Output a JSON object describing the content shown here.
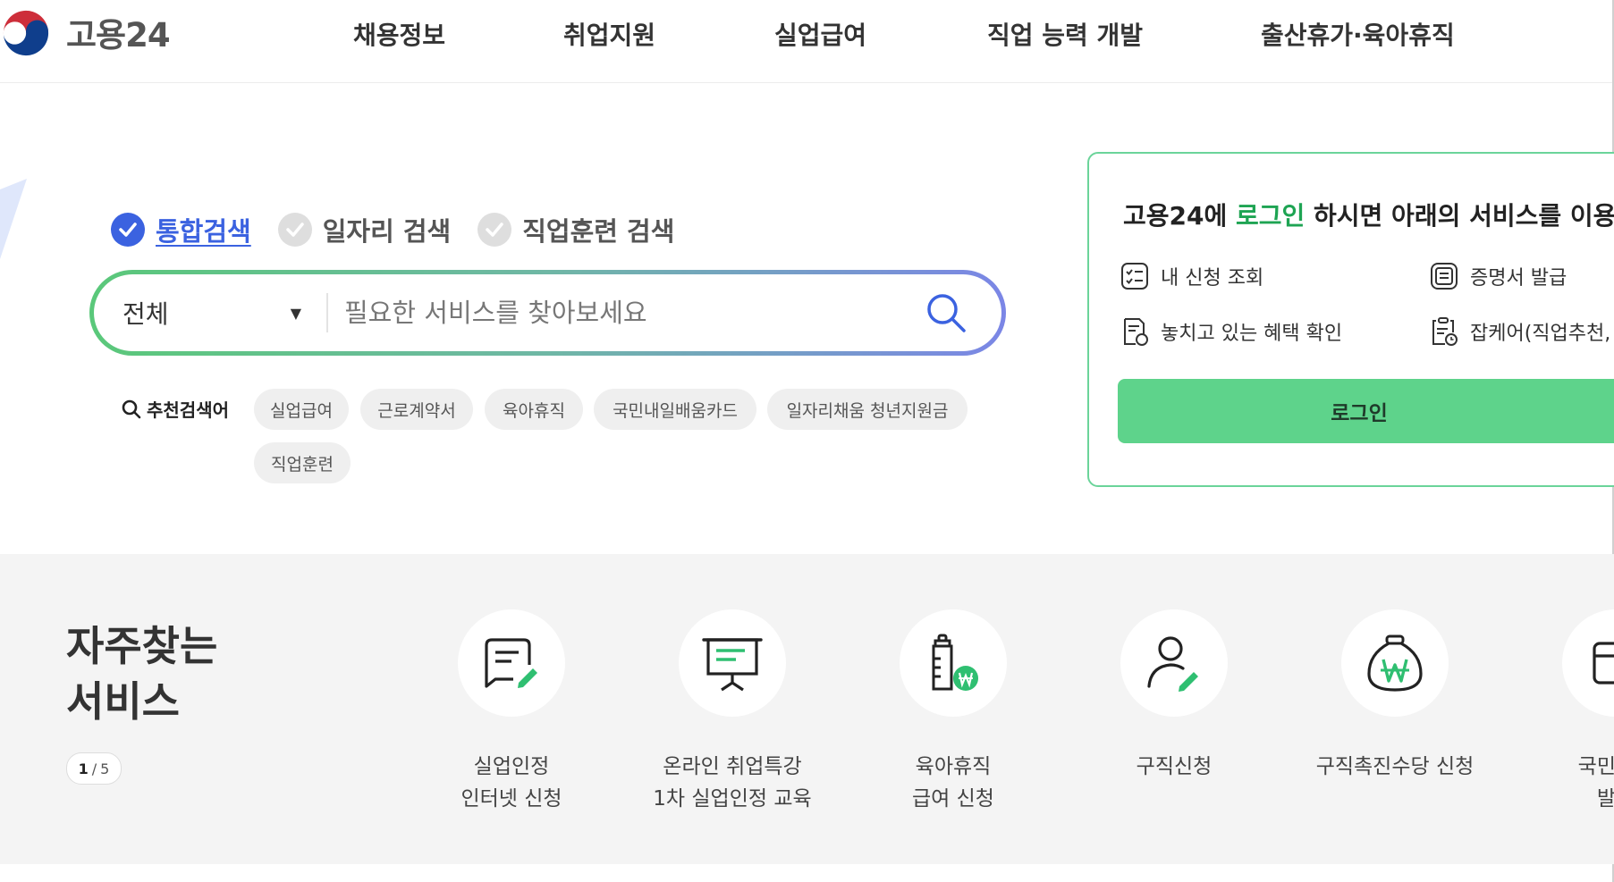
{
  "header": {
    "logo_text": "고용24",
    "nav": [
      "채용정보",
      "취업지원",
      "실업급여",
      "직업 능력 개발",
      "출산휴가·육아휴직"
    ]
  },
  "search": {
    "tabs": [
      {
        "label": "통합검색",
        "active": true
      },
      {
        "label": "일자리 검색",
        "active": false
      },
      {
        "label": "직업훈련 검색",
        "active": false
      }
    ],
    "category": "전체",
    "placeholder": "필요한 서비스를 찾아보세요",
    "recommended_label": "추천검색어",
    "keywords": [
      "실업급여",
      "근로계약서",
      "육아휴직",
      "국민내일배움카드",
      "일자리채움 청년지원금",
      "직업훈련"
    ]
  },
  "login_panel": {
    "message_pre": "고용24에 ",
    "message_highlight": "로그인",
    "message_post": " 하시면 아래의 서비스를 이용할",
    "services": [
      {
        "label": "내 신청 조회",
        "icon": "checklist-icon"
      },
      {
        "label": "증명서 발급",
        "icon": "certificate-icon"
      },
      {
        "label": "놓치고 있는 혜택 확인",
        "icon": "benefit-doc-icon"
      },
      {
        "label": "잡케어(직업추천,",
        "icon": "jobcare-doc-icon"
      }
    ],
    "login_button": "로그인"
  },
  "frequent": {
    "title_line1": "자주찾는",
    "title_line2": "서비스",
    "pager_current": "1",
    "pager_sep": "/",
    "pager_total": "5",
    "items": [
      {
        "line1": "실업인정",
        "line2": "인터넷 신청",
        "icon": "document-edit-icon"
      },
      {
        "line1": "온라인 취업특강",
        "line2": "1차 실업인정 교육",
        "icon": "presentation-board-icon"
      },
      {
        "line1": "육아휴직",
        "line2": "급여 신청",
        "icon": "baby-bottle-won-icon"
      },
      {
        "line1": "구직신청",
        "line2": "",
        "icon": "person-edit-icon"
      },
      {
        "line1": "구직촉진수당 신청",
        "line2": "",
        "icon": "money-bag-icon"
      },
      {
        "line1": "국민내일",
        "line2": "발급",
        "icon": "card-icon"
      }
    ]
  },
  "colors": {
    "accent_blue": "#3b62e0",
    "accent_green": "#1ea453",
    "login_button": "#5ed38b",
    "gradient_start": "#5ac87a",
    "gradient_end": "#7b86e6"
  }
}
